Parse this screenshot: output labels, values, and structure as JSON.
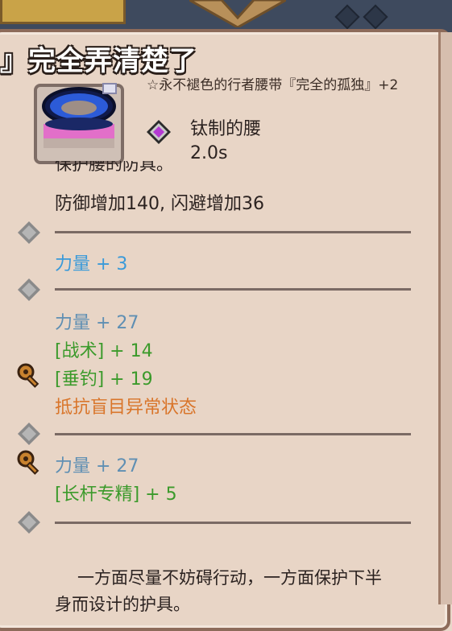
{
  "header": {
    "title": "』完全弄清楚了"
  },
  "item": {
    "icon": "blue-belt-icon",
    "name": "☆永不褪色的行者腰带『完全的孤独』+2",
    "slot_icon": "purple-gem-icon",
    "slot": "钛制的腰",
    "cooldown": "2.0s"
  },
  "description": {
    "cut_line": "保护腰的防具。",
    "effect": "防御增加140, 闪避增加36"
  },
  "stat_blocks": [
    {
      "lines": [
        {
          "text": "力量 + 3",
          "color": "#3a9ad9"
        }
      ]
    },
    {
      "lines": [
        {
          "text": "力量 + 27",
          "color": "#5f8fb3"
        },
        {
          "text": "[战术] + 14",
          "color": "#3b9a2b"
        },
        {
          "text": "[垂钓] + 19",
          "color": "#3b9a2b"
        },
        {
          "text": "抵抗盲目异常状态",
          "color": "#d9752a"
        }
      ]
    },
    {
      "lines": [
        {
          "text": "力量 + 27",
          "color": "#5f8fb3"
        },
        {
          "text": "[长杆专精] + 5",
          "color": "#3b9a2b"
        }
      ]
    }
  ],
  "flavor_text": "一方面尽量不妨碍行动，一方面保护下半身而设计的护具。",
  "colors": {
    "panel": "#e8d5c6",
    "border": "#8d6b5a",
    "divider": "#7a6a64"
  },
  "icons": {
    "empty_socket": "gray-diamond-socket-icon",
    "key": "bronze-key-icon"
  }
}
